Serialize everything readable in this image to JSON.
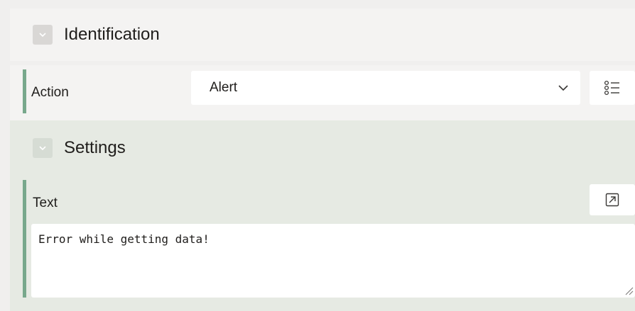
{
  "sections": {
    "identification": {
      "title": "Identification",
      "collapse_icon": "chevron-down-icon"
    },
    "settings": {
      "title": "Settings",
      "collapse_icon": "chevron-down-icon"
    }
  },
  "action": {
    "label": "Action",
    "value": "Alert",
    "dropdown_icon": "chevron-down-icon",
    "list_icon": "list-icon"
  },
  "text_field": {
    "label": "Text",
    "value": "Error while getting data!",
    "expand_icon": "expand-icon"
  },
  "colors": {
    "accent_rule": "#78a88c",
    "settings_bg": "#e6eae3",
    "identification_bg": "#f4f3f2"
  }
}
